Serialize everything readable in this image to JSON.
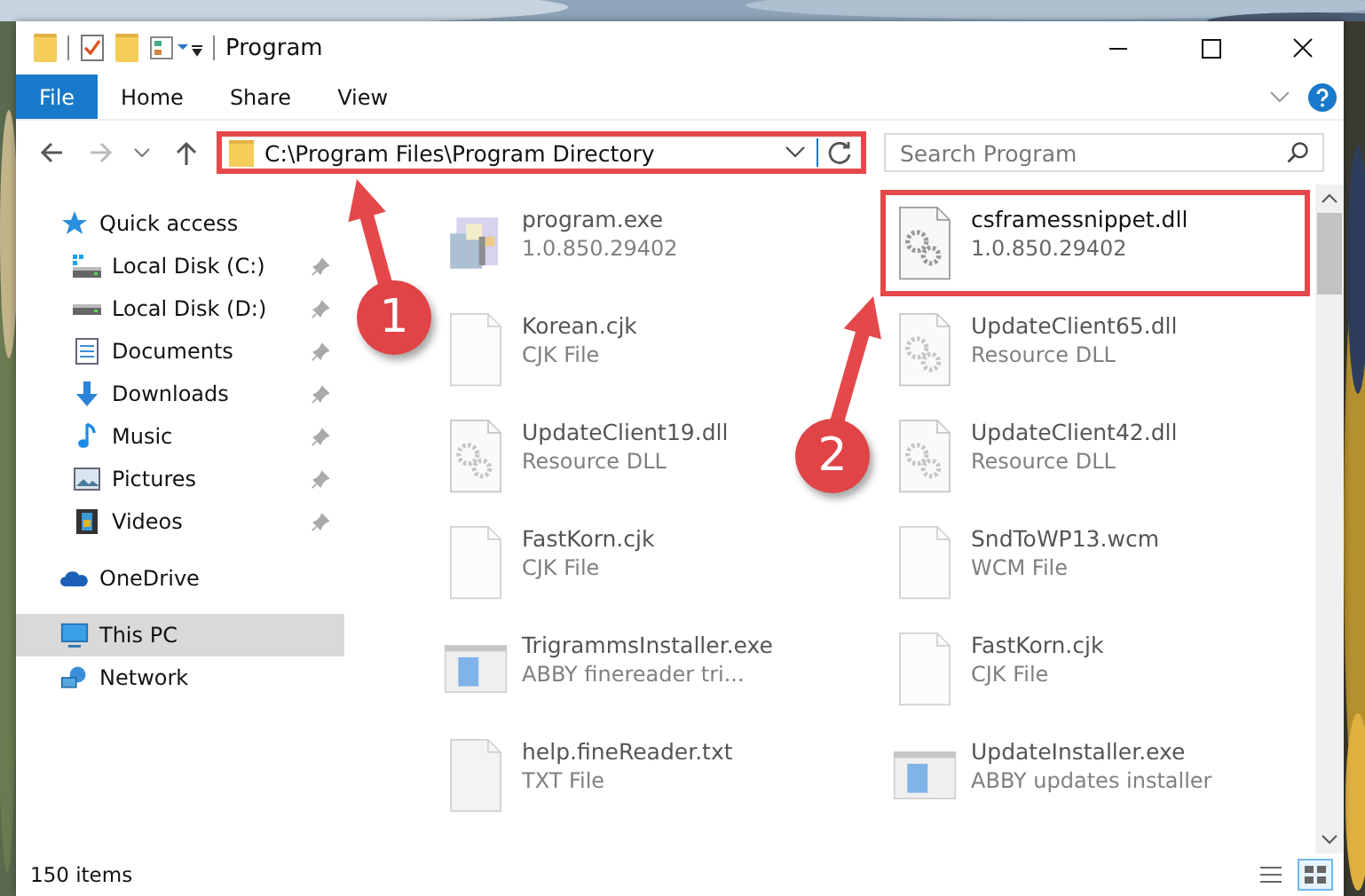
{
  "window": {
    "title": "Program"
  },
  "ribbon": {
    "file_button": "File",
    "tabs": [
      {
        "label": "Home",
        "selected": false
      },
      {
        "label": "Share",
        "selected": false
      },
      {
        "label": "View",
        "selected": false
      }
    ]
  },
  "address_bar": {
    "path": "C:\\Program Files\\Program Directory",
    "highlighted": true
  },
  "search": {
    "placeholder": "Search Program"
  },
  "sidebar": {
    "items": [
      {
        "label": "Quick access",
        "kind": "star",
        "selected": false,
        "children": [
          {
            "label": "Local Disk (C:)",
            "kind": "system-drive",
            "pinned": true,
            "selected": false
          },
          {
            "label": "Local Disk (D:)",
            "kind": "drive",
            "pinned": true,
            "selected": false
          },
          {
            "label": "Documents",
            "kind": "documents",
            "pinned": true,
            "selected": false
          },
          {
            "label": "Downloads",
            "kind": "downloads",
            "pinned": true,
            "selected": false
          },
          {
            "label": "Music",
            "kind": "music",
            "pinned": true,
            "selected": false
          },
          {
            "label": "Pictures",
            "kind": "pictures",
            "pinned": true,
            "selected": false
          },
          {
            "label": "Videos",
            "kind": "videos",
            "pinned": true,
            "selected": false
          }
        ]
      },
      {
        "label": "OneDrive",
        "kind": "cloud",
        "selected": false
      },
      {
        "label": "This PC",
        "kind": "pc",
        "selected": true
      },
      {
        "label": "Network",
        "kind": "network",
        "selected": false
      }
    ]
  },
  "files": [
    {
      "name": "program.exe",
      "detail": "1.0.850.29402",
      "kind": "program",
      "blurred": true,
      "highlighted": false
    },
    {
      "name": "csframessnippet.dll",
      "detail": "1.0.850.29402",
      "kind": "dll",
      "blurred": false,
      "highlighted": true
    },
    {
      "name": "Korean.cjk",
      "detail": "CJK File",
      "kind": "document",
      "blurred": true,
      "highlighted": false
    },
    {
      "name": "UpdateClient65.dll",
      "detail": "Resource DLL",
      "kind": "dll",
      "blurred": true,
      "highlighted": false
    },
    {
      "name": "UpdateClient19.dll",
      "detail": "Resource DLL",
      "kind": "dll",
      "blurred": true,
      "highlighted": false
    },
    {
      "name": "UpdateClient42.dll",
      "detail": "Resource DLL",
      "kind": "dll",
      "blurred": true,
      "highlighted": false
    },
    {
      "name": "FastKorn.cjk",
      "detail": "CJK File",
      "kind": "document",
      "blurred": true,
      "highlighted": false
    },
    {
      "name": "SndToWP13.wcm",
      "detail": "WCM File",
      "kind": "document",
      "blurred": true,
      "highlighted": false
    },
    {
      "name": "TrigrammsInstaller.exe",
      "detail": "ABBY finereader tri...",
      "kind": "installer",
      "blurred": true,
      "highlighted": false
    },
    {
      "name": "FastKorn.cjk",
      "detail": "CJK File",
      "kind": "document",
      "blurred": true,
      "highlighted": false
    },
    {
      "name": "help.fineReader.txt",
      "detail": "TXT File",
      "kind": "text",
      "blurred": true,
      "highlighted": false
    },
    {
      "name": "UpdateInstaller.exe",
      "detail": "ABBY updates installer",
      "kind": "installer",
      "blurred": true,
      "highlighted": false
    }
  ],
  "status_bar": {
    "item_count": "150 items"
  },
  "annotations": [
    {
      "number": "1"
    },
    {
      "number": "2"
    }
  ]
}
